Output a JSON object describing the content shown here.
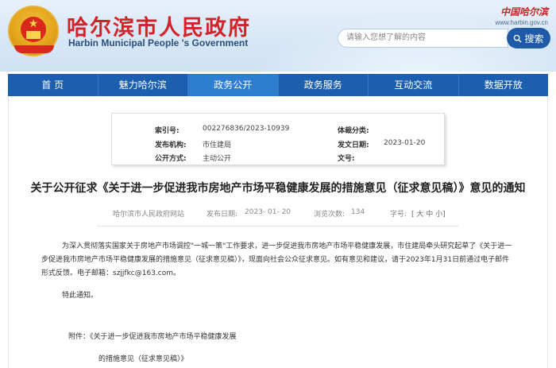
{
  "header": {
    "title": "哈尔滨市人民政府",
    "subtitle": "Harbin Municipal People 's Government",
    "logo_text": "中国哈尔滨",
    "logo_url": "www.harbin.gov.cn",
    "search_placeholder": "请输入您想了解的内容",
    "search_label": "搜索"
  },
  "nav": {
    "items": [
      "首 页",
      "魅力哈尔滨",
      "政务公开",
      "政务服务",
      "互动交流",
      "数据开放"
    ],
    "active_index": 2
  },
  "meta": {
    "index_label": "索引号:",
    "index_value": "002276836/2023-10939",
    "category_label": "体裁分类:",
    "category_value": "",
    "publisher_label": "发布机构:",
    "publisher_value": "市住建局",
    "date_label": "发文日期:",
    "date_value": "2023-01-20",
    "method_label": "公开方式:",
    "method_value": "主动公开",
    "docno_label": "文号:",
    "docno_value": ""
  },
  "article": {
    "title": "关于公开征求《关于进一步促进我市房地产市场平稳健康发展的措施意见（征求意见稿）》意见的通知",
    "source": "哈尔滨市人民政府网站",
    "publish_date_label": "发布日期:",
    "publish_date": "2023- 01- 20",
    "views_label": "浏览次数:",
    "views": "134",
    "font_size_label": "字号:",
    "font_size_options": "[ 大 中 小]",
    "body": "为深入贯彻落实国家关于房地产市场调控\"一城一策\"工作要求，进一步促进我市房地产市场平稳健康发展，市住建局牵头研究起草了《关于进一步促进我市房地产市场平稳健康发展的措施意见（征求意见稿）》，现面向社会公众征求意见。如有意见和建议，请于2023年1月31日前通过电子邮件形式反馈。电子邮箱：szjjfkc@163.com。",
    "closing": "特此通知。",
    "attachment_line1": "附件：《关于进一步促进我市房地产市场平稳健康发展",
    "attachment_line2": "的措施意见（征求意见稿）》"
  },
  "colors": {
    "nav_bg": "#1c5fae",
    "nav_active": "#2e7dd1",
    "title_red": "#d0242a",
    "search_btn": "#1e5aa8"
  }
}
